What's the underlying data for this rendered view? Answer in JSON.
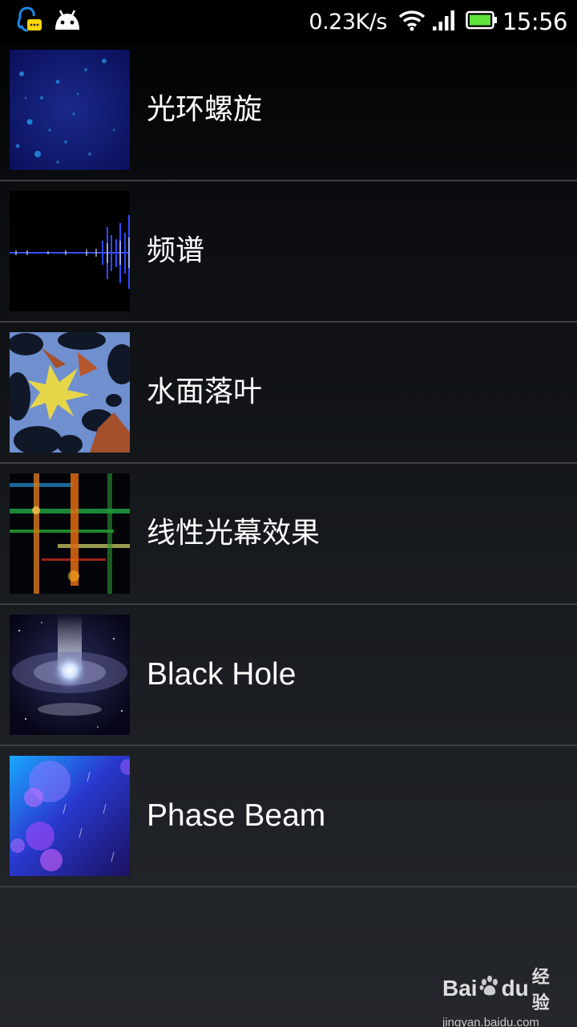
{
  "status_bar": {
    "left_icons": [
      "qq-notification-icon",
      "android-icon"
    ],
    "net_speed": "0.23K/s",
    "right_icons": [
      "wifi-icon",
      "signal-icon",
      "battery-icon"
    ],
    "battery_color": "#5fe23a",
    "time": "15:56"
  },
  "wallpapers": [
    {
      "label": "光环螺旋",
      "thumbnail": "halo-spiral-thumbnail"
    },
    {
      "label": "频谱",
      "thumbnail": "spectrum-thumbnail"
    },
    {
      "label": "水面落叶",
      "thumbnail": "falling-leaves-thumbnail"
    },
    {
      "label": "线性光幕效果",
      "thumbnail": "linear-light-curtain-thumbnail"
    },
    {
      "label": "Black Hole",
      "thumbnail": "black-hole-thumbnail"
    },
    {
      "label": "Phase Beam",
      "thumbnail": "phase-beam-thumbnail"
    }
  ],
  "watermark": {
    "logo_left": "Bai",
    "logo_right": "du",
    "logo_cn": "经验",
    "url": "jingyan.baidu.com"
  }
}
